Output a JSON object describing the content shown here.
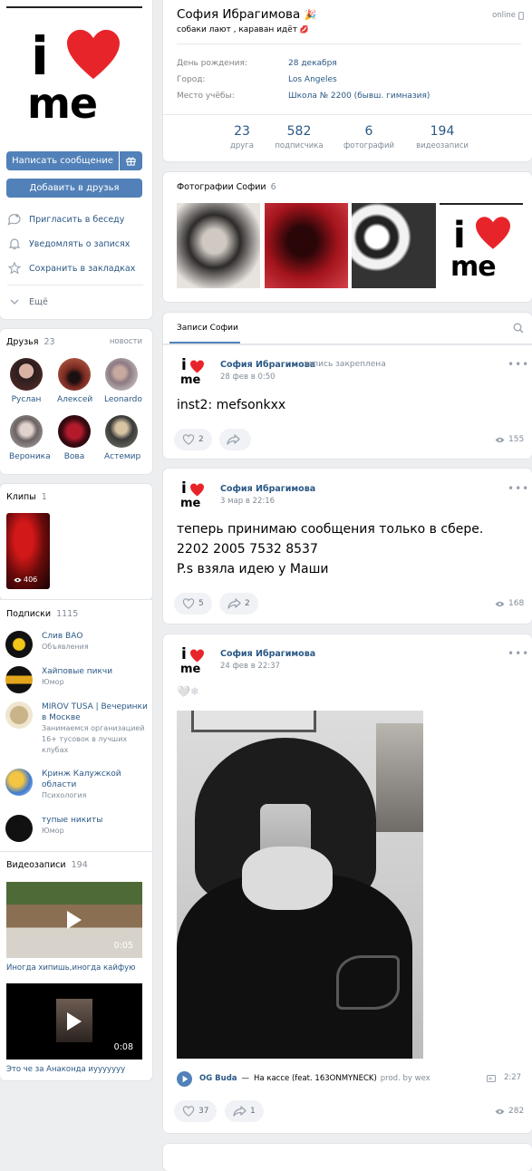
{
  "profile": {
    "name": "София Ибрагимова",
    "name_emoji": "🎉",
    "status": "собаки лают , караван идёт",
    "status_emoji": "💋",
    "online": "online",
    "info": [
      {
        "label": "День рождения:",
        "value": "28 декабря"
      },
      {
        "label": "Город:",
        "value": "Los Angeles"
      },
      {
        "label": "Место учёбы:",
        "value": "Школа № 2200 (бывш. гимназия)"
      }
    ],
    "stats": [
      {
        "num": "23",
        "label": "друга"
      },
      {
        "num": "582",
        "label": "подписчика"
      },
      {
        "num": "6",
        "label": "фотографий"
      },
      {
        "num": "194",
        "label": "видеозаписи"
      }
    ]
  },
  "avatar": {
    "line1": "i",
    "line2": "me"
  },
  "actions": {
    "message": "Написать сообщение",
    "add_friend": "Добавить в друзья",
    "menu": [
      {
        "label": "Пригласить в беседу",
        "icon": "chat-invite-icon"
      },
      {
        "label": "Уведомлять о записях",
        "icon": "bell-icon"
      },
      {
        "label": "Сохранить в закладках",
        "icon": "star-icon"
      },
      {
        "label": "Ещё",
        "icon": "chevron-down-icon"
      }
    ]
  },
  "friends": {
    "title": "Друзья",
    "count": "23",
    "link": "новости",
    "list": [
      "Руслан",
      "Алексей",
      "Leonardo",
      "Вероника",
      "Вова",
      "Астемир"
    ]
  },
  "clips": {
    "title": "Клипы",
    "count": "1",
    "views": "406"
  },
  "subscriptions": {
    "title": "Подписки",
    "count": "1115",
    "list": [
      {
        "name": "Слив ВАО",
        "desc": "Объявления"
      },
      {
        "name": "Хайповые пикчи",
        "desc": "Юмор"
      },
      {
        "name": "MIROV TUSA | Вечеринки в Москве",
        "desc": "Занимаемся организацией 16+ тусовок в лучших клубах"
      },
      {
        "name": "Кринж Калужской области",
        "desc": "Психология"
      },
      {
        "name": "тупые никиты",
        "desc": "Юмор"
      }
    ]
  },
  "videos": {
    "title": "Видеозаписи",
    "count": "194",
    "list": [
      {
        "title": "Иногда хипишь,иногда кайфую",
        "duration": "0:05"
      },
      {
        "title": "Это че за Анаконда иууууууу",
        "duration": "0:08"
      }
    ]
  },
  "photos": {
    "title": "Фотографии Софии",
    "count": "6"
  },
  "wall": {
    "tab": "Записи Софии",
    "posts": [
      {
        "author": "София Ибрагимова",
        "pinned": "запись закреплена",
        "date": "28 фев в 0:50",
        "text": [
          "inst2: mefsonkxx"
        ],
        "likes": "2",
        "shares": "",
        "views": "155"
      },
      {
        "author": "София Ибрагимова",
        "date": "3 мар в 22:16",
        "text": [
          "теперь принимаю сообщения только в сбере.",
          "2202 2005 7532 8537",
          "P.s взяла идею у Маши"
        ],
        "likes": "5",
        "shares": "2",
        "views": "168"
      },
      {
        "author": "София Ибрагимова",
        "date": "24 фев в 22:37",
        "text": [
          "🤍❄"
        ],
        "likes": "37",
        "shares": "1",
        "views": "282",
        "audio": {
          "artist": "OG Buda",
          "dash": "—",
          "title": "На кассе (feat. 163ONMYNECK)",
          "prod": "prod. by wex",
          "duration": "2:27"
        }
      }
    ]
  },
  "colors": {
    "accent": "#5181b8",
    "link": "#2a5885",
    "heart": "#e8242b"
  }
}
